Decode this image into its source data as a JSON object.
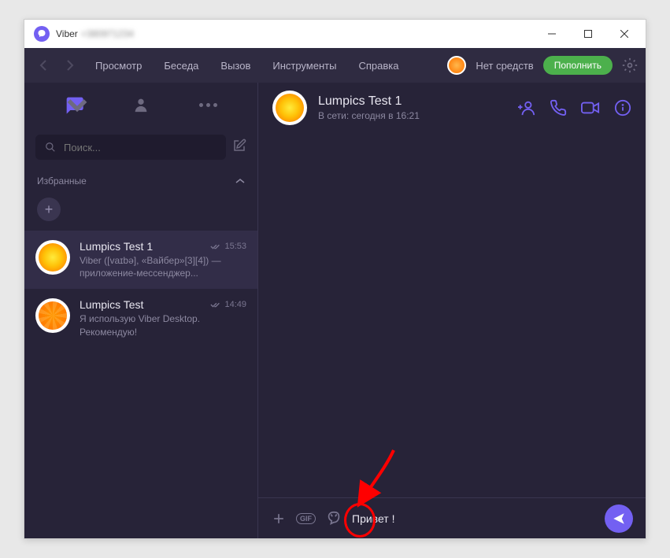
{
  "titlebar": {
    "app_name": "Viber",
    "subtitle_blur": "+380971234"
  },
  "menu": {
    "items": [
      "Просмотр",
      "Беседа",
      "Вызов",
      "Инструменты",
      "Справка"
    ],
    "credit_label": "Нет средств",
    "topup_label": "Пополнить"
  },
  "sidebar": {
    "search_placeholder": "Поиск...",
    "section_label": "Избранные",
    "chats": [
      {
        "name": "Lumpics Test 1",
        "time": "15:53",
        "preview": "Viber ([vaɪbə], «Вайбер»[3][4]) — приложение-мессенджер..."
      },
      {
        "name": "Lumpics Test",
        "time": "14:49",
        "preview": "Я использую Viber Desktop. Рекомендую!"
      }
    ]
  },
  "chat": {
    "name": "Lumpics Test 1",
    "status": "В сети: сегодня в 16:21",
    "input_value": "Привет ! "
  }
}
